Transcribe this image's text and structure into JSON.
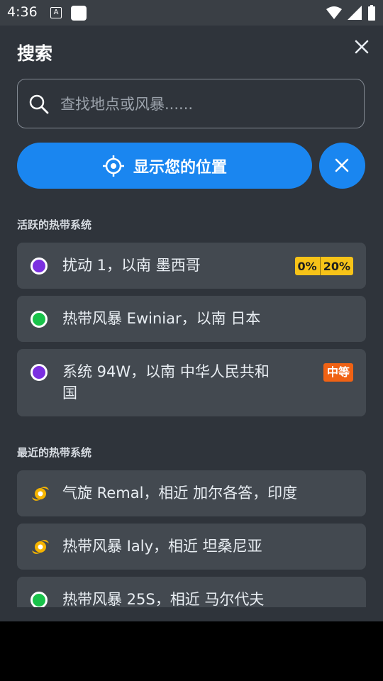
{
  "status": {
    "time": "4:36",
    "notification_letter": "A"
  },
  "header": {
    "title": "搜索"
  },
  "search": {
    "placeholder": "查找地点或风暴......"
  },
  "location_button": {
    "label": "显示您的位置"
  },
  "sections": {
    "active": "活跃的热带系统",
    "recent": "最近的热带系统"
  },
  "active_items": [
    {
      "label": "扰动 1，以南 墨西哥",
      "dot_color": "#7b2fe0",
      "badge_low": "0%",
      "badge_high": "20%"
    },
    {
      "label": "热带风暴 Ewiniar，以南 日本",
      "dot_color": "#19c24a"
    },
    {
      "label_line1": "系统 94W，以南 中华人民共和",
      "label_line2": "国",
      "dot_color": "#7b2fe0",
      "badge": "中等"
    }
  ],
  "recent_items": [
    {
      "label": "气旋 Remal，相近 加尔各答，印度",
      "icon": "cyclone-icon"
    },
    {
      "label": "热带风暴 Ialy，相近 坦桑尼亚",
      "icon": "cyclone-icon"
    },
    {
      "label": "热带风暴 25S，相近 马尔代夫",
      "dot_color": "#19c24a"
    }
  ],
  "colors": {
    "accent": "#1a86f0",
    "background": "#2f343b",
    "card": "#434950",
    "badge_yellow": "#f7c318",
    "badge_orange": "#f06214"
  }
}
